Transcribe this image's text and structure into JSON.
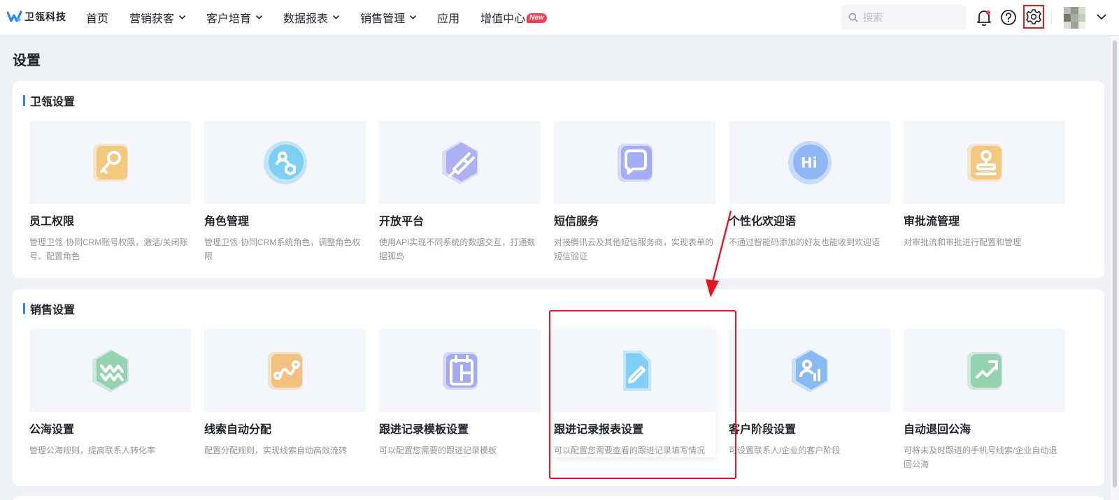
{
  "app": {
    "logo_text": "卫瓴科技"
  },
  "nav": {
    "items": [
      {
        "label": "首页",
        "has_dropdown": false
      },
      {
        "label": "营销获客",
        "has_dropdown": true
      },
      {
        "label": "客户培育",
        "has_dropdown": true
      },
      {
        "label": "数据报表",
        "has_dropdown": true
      },
      {
        "label": "销售管理",
        "has_dropdown": true
      },
      {
        "label": "应用",
        "has_dropdown": false
      },
      {
        "label": "增值中心",
        "has_dropdown": false,
        "badge": "New"
      }
    ]
  },
  "header": {
    "search_placeholder": "搜索",
    "icons": [
      "bell-icon",
      "help-icon",
      "gear-icon"
    ]
  },
  "page": {
    "title": "设置"
  },
  "sections": [
    {
      "title": "卫瓴设置",
      "cards": [
        {
          "title": "员工权限",
          "desc": "管理卫瓴·协同CRM账号权限，激活/关闭账号、配置角色",
          "icon": "key-icon",
          "color": "#f5a623"
        },
        {
          "title": "角色管理",
          "desc": "管理卫瓴·协同CRM系统角色，调整角色权限",
          "icon": "role-icon",
          "color": "#2bb5f0"
        },
        {
          "title": "开放平台",
          "desc": "使用API实现不同系统的数据交互，打通数据孤岛",
          "icon": "plug-icon",
          "color": "#7a7fe8"
        },
        {
          "title": "短信服务",
          "desc": "对接腾讯云及其他短信服务商，实现表单的短信验证",
          "icon": "message-icon",
          "color": "#6a78f0"
        },
        {
          "title": "个性化欢迎语",
          "desc": "不通过智能码添加的好友也能收到欢迎语",
          "icon": "hi-bubble-icon",
          "color": "#4a8cf5"
        },
        {
          "title": "审批流管理",
          "desc": "对审批流和审批进行配置和管理",
          "icon": "stamp-icon",
          "color": "#f5a623"
        }
      ]
    },
    {
      "title": "销售设置",
      "cards": [
        {
          "title": "公海设置",
          "desc": "管理公海规则，提高联系人转化率",
          "icon": "waves-icon",
          "color": "#4fb878"
        },
        {
          "title": "线索自动分配",
          "desc": "配置分配规则，实现线索自动高效流转",
          "icon": "route-icon",
          "color": "#f59a23"
        },
        {
          "title": "跟进记录模板设置",
          "desc": "可以配置您需要的跟进记录模板",
          "icon": "calendar-template-icon",
          "color": "#6a72e8"
        },
        {
          "title": "跟进记录报表设置",
          "desc": "可以配置您需要查看的跟进记录填写情况",
          "icon": "edit-doc-icon",
          "color": "#3db8f5"
        },
        {
          "title": "客户阶段设置",
          "desc": "可设置联系人/企业的客户阶段",
          "icon": "user-stats-icon",
          "color": "#3a8cf0"
        },
        {
          "title": "自动退回公海",
          "desc": "可将未及时跟进的手机号线索/企业自动退回公海",
          "icon": "return-chart-icon",
          "color": "#4fb878"
        }
      ]
    }
  ]
}
